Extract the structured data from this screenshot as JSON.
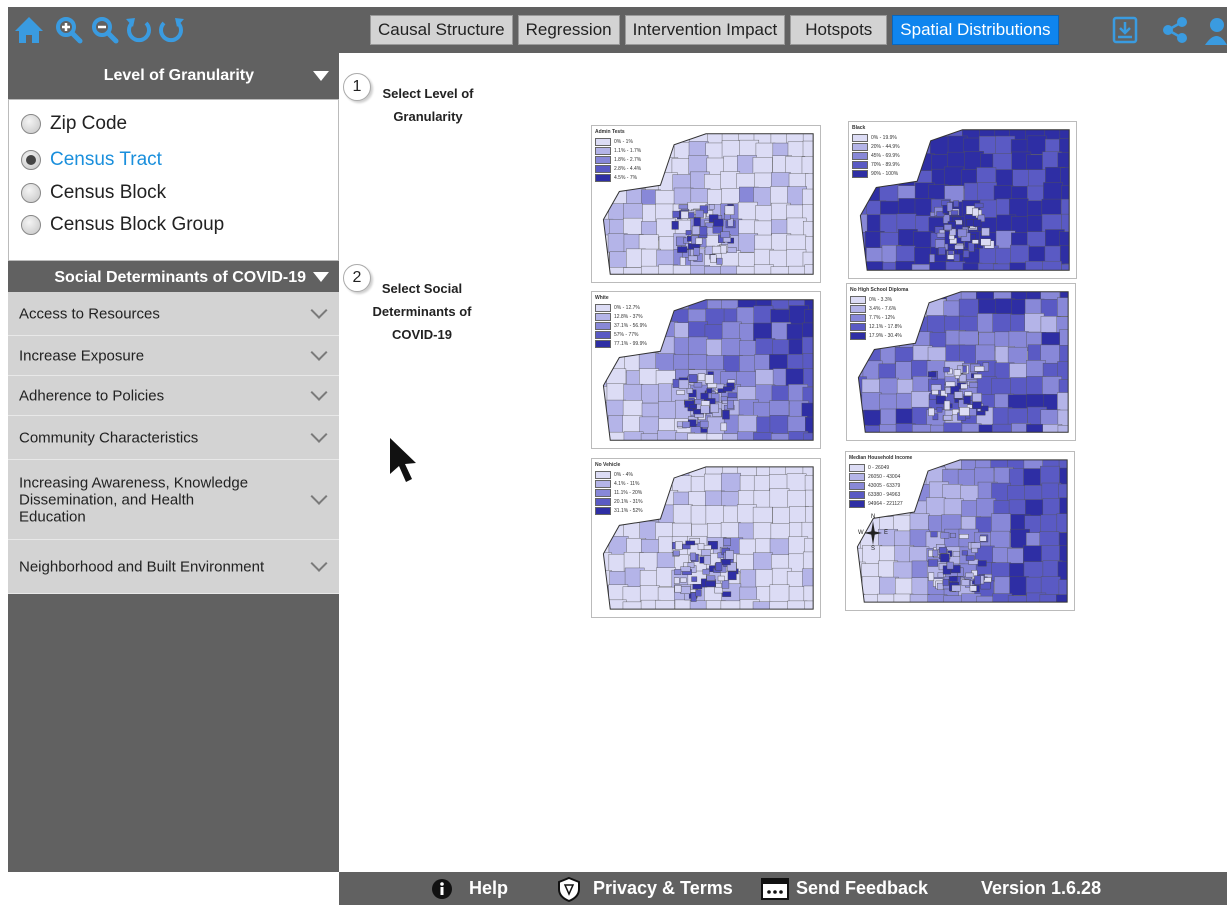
{
  "toolbar": {
    "icons": [
      "home-icon",
      "zoom-in-icon",
      "zoom-out-icon",
      "undo-icon",
      "redo-icon"
    ],
    "tabs": [
      {
        "label": "Causal Structure",
        "active": false
      },
      {
        "label": "Regression",
        "active": false
      },
      {
        "label": "Intervention Impact",
        "active": false
      },
      {
        "label": "Hotspots",
        "active": false
      },
      {
        "label": "Spatial Distributions",
        "active": true
      }
    ],
    "right_icons": [
      "download-icon",
      "share-icon",
      "user-icon"
    ]
  },
  "sidebar": {
    "granularity": {
      "title": "Level of Granularity",
      "options": [
        {
          "label": "Zip Code",
          "checked": false
        },
        {
          "label": "Census Tract",
          "checked": true
        },
        {
          "label": "Census Block",
          "checked": false
        },
        {
          "label": "Census Block Group",
          "checked": false
        }
      ]
    },
    "social": {
      "title": "Social Determinants of COVID-19",
      "items": [
        {
          "label": "Access to Resources"
        },
        {
          "label": "Increase Exposure"
        },
        {
          "label": "Adherence to Policies"
        },
        {
          "label": "Community Characteristics"
        },
        {
          "label": "Increasing Awareness, Knowledge Dissemination, and Health Education"
        },
        {
          "label": "Neighborhood and Built Environment"
        }
      ]
    }
  },
  "main": {
    "steps": [
      {
        "number": "1",
        "text": "Select Level of Granularity"
      },
      {
        "number": "2",
        "text": "Select Social Determinants of COVID-19"
      }
    ],
    "maps": [
      {
        "legend_title": "Admin Tests",
        "legend_items": [
          "0% - 1%",
          "1.1% - 1.7%",
          "1.8% - 2.7%",
          "2.8% - 4.4%",
          "4.5% - 7%"
        ]
      },
      {
        "legend_title": "Black",
        "legend_items": [
          "0% - 19.9%",
          "20% - 44.9%",
          "45% - 69.9%",
          "70% - 89.9%",
          "90% - 100%"
        ]
      },
      {
        "legend_title": "White",
        "legend_items": [
          "0% - 12.7%",
          "12.8% - 37%",
          "37.1% - 56.9%",
          "57% - 77%",
          "77.1% - 99.9%"
        ]
      },
      {
        "legend_title": "No High School Diploma",
        "legend_items": [
          "0% - 3.3%",
          "3.4% - 7.6%",
          "7.7% - 12%",
          "12.1% - 17.8%",
          "17.9% - 30.4%"
        ]
      },
      {
        "legend_title": "No Vehicle",
        "legend_items": [
          "0% - 4%",
          "4.1% - 11%",
          "11.1% - 20%",
          "20.1% - 31%",
          "31.1% - 52%"
        ]
      },
      {
        "legend_title": "Median Household Income",
        "legend_items": [
          "0 - 26049",
          "26050 - 43004",
          "43005 - 63379",
          "63380 - 94963",
          "94964 - 221127"
        ]
      }
    ],
    "compass": {
      "n": "N",
      "s": "S",
      "e": "E",
      "w": "W"
    }
  },
  "footer": {
    "help": "Help",
    "privacy": "Privacy & Terms",
    "feedback": "Send Feedback",
    "version": "Version 1.6.28"
  },
  "colors": {
    "bar": "#616161",
    "tab_active": "#0f85ee",
    "accent_icon": "#3a9be0",
    "map_palette": [
      "#dcdcf5",
      "#b4b4e8",
      "#8888d8",
      "#5a5ac4",
      "#2e2ea4"
    ]
  }
}
